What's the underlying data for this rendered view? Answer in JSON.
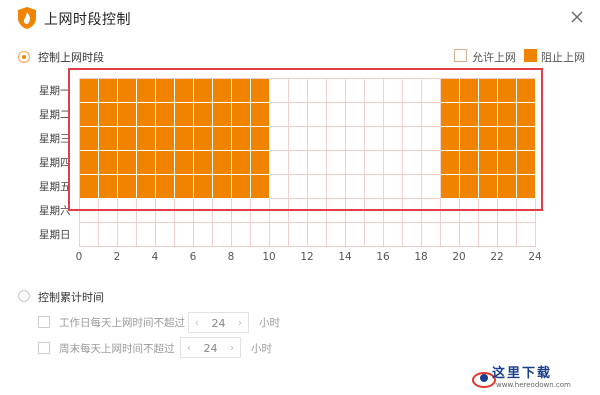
{
  "window": {
    "title": "上网时段控制",
    "logo": "shield-flame-logo",
    "close_icon": "close-icon"
  },
  "control_period": {
    "label": "控制上网时段",
    "selected": true,
    "legend": {
      "allow": "允许上网",
      "block": "阻止上网"
    },
    "days": [
      "星期一",
      "星期二",
      "星期三",
      "星期四",
      "星期五",
      "星期六",
      "星期日"
    ],
    "ticks": [
      "0",
      "2",
      "4",
      "6",
      "8",
      "10",
      "12",
      "14",
      "16",
      "18",
      "20",
      "22",
      "24"
    ],
    "blocked_ranges": [
      {
        "days": [
          0,
          1,
          2,
          3,
          4
        ],
        "from_hour": 0,
        "to_hour": 10
      },
      {
        "days": [
          0,
          1,
          2,
          3,
          4
        ],
        "from_hour": 19,
        "to_hour": 24
      }
    ],
    "colors": {
      "blocked": "#f08300",
      "grid_line": "#f0cfcf",
      "highlight_frame": "#e33d47"
    }
  },
  "control_total": {
    "label": "控制累计时间",
    "selected": false,
    "weekday": {
      "label": "工作日每天上网时间不超过",
      "value": "24",
      "unit": "小时"
    },
    "weekend": {
      "label": "周末每天上网时间不超过",
      "value": "24",
      "unit": "小时"
    }
  },
  "watermark": {
    "text": "这里下载",
    "url": "www.hereodown.com"
  }
}
